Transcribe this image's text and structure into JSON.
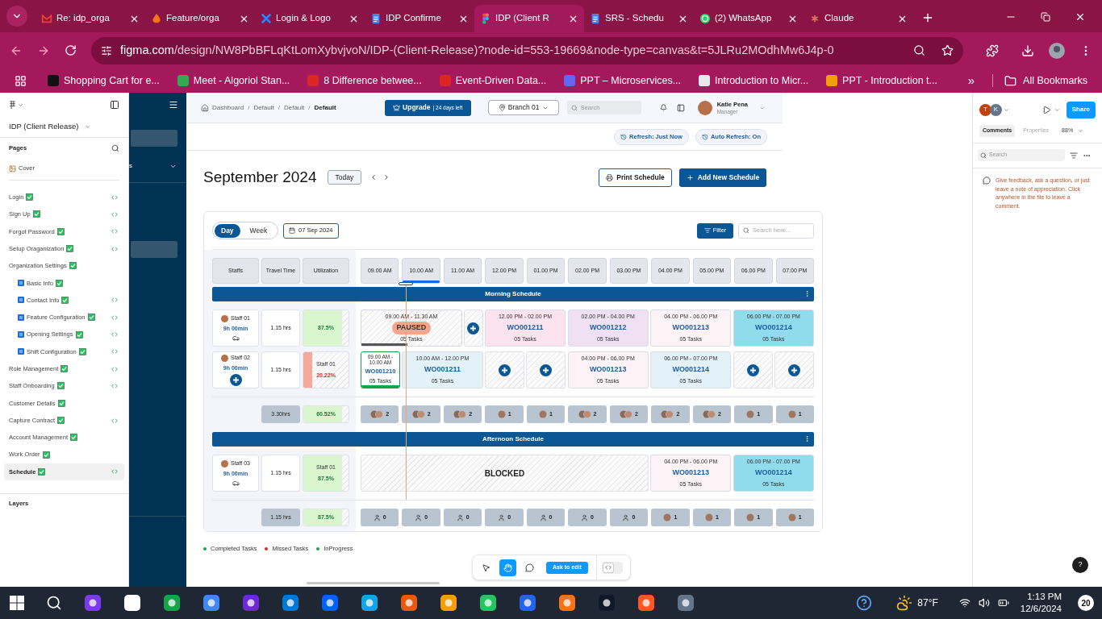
{
  "browser": {
    "tabs": [
      {
        "title": "Re: idp_orga",
        "selected": false
      },
      {
        "title": "Feature/orga",
        "selected": false
      },
      {
        "title": "Login & Logo",
        "selected": false
      },
      {
        "title": "IDP Confirme",
        "selected": false
      },
      {
        "title": "IDP (Client R",
        "selected": true
      },
      {
        "title": "SRS - Schedu",
        "selected": false
      },
      {
        "title": "(2) WhatsApp",
        "selected": false
      },
      {
        "title": "Claude",
        "selected": false
      }
    ],
    "url_domain": "figma.com",
    "url_path": "/design/NW8PbBFLqKtLomXybvjvoN/IDP-(Client-Release)?node-id=553-19669&node-type=canvas&t=5JLRu2MOdhMw6J4p-0",
    "bookmarks": [
      "Shopping Cart for e...",
      "Meet - Algoriol Stan...",
      "8 Difference betwee...",
      "Event-Driven Data...",
      "PPT – Microservices...",
      "Introduction to Micr...",
      "PPT - Introduction t..."
    ],
    "bookmarks_more": "»",
    "all_bookmarks": "All Bookmarks"
  },
  "figma": {
    "file": "IDP (Client Release)",
    "pages_title": "Pages",
    "cover": "Cover",
    "layers_title": "Layers",
    "pages": [
      {
        "name": "Login",
        "done": true,
        "dev": true,
        "selected": false
      },
      {
        "name": "Sign Up",
        "done": true,
        "dev": true,
        "selected": false
      },
      {
        "name": "Forgot Password",
        "done": true,
        "dev": true,
        "selected": false
      },
      {
        "name": "Setup Oraganization",
        "done": true,
        "dev": true,
        "selected": false
      },
      {
        "name": "Organization Settings",
        "done": true,
        "dev": false,
        "selected": false,
        "children": [
          {
            "name": "Basic Info",
            "done": true,
            "dev": false,
            "selected": false
          },
          {
            "name": "Contact Info",
            "done": true,
            "dev": true,
            "selected": false
          },
          {
            "name": "Feature Configuration",
            "done": true,
            "dev": true,
            "selected": false
          },
          {
            "name": "Opening Settings",
            "done": true,
            "dev": true,
            "selected": false
          },
          {
            "name": "Shift Configuration",
            "done": true,
            "dev": true,
            "selected": false
          }
        ]
      },
      {
        "name": "Role Management",
        "done": true,
        "dev": true,
        "selected": false
      },
      {
        "name": "Staff Onboarding",
        "done": true,
        "dev": true,
        "selected": false
      },
      {
        "name": "Customer Details",
        "done": true,
        "dev": false,
        "selected": false
      },
      {
        "name": "Capture Contract",
        "done": true,
        "dev": true,
        "selected": false
      },
      {
        "name": "Account Management",
        "done": true,
        "dev": false,
        "selected": false
      },
      {
        "name": "Work Order",
        "done": true,
        "dev": false,
        "selected": false
      },
      {
        "name": "Schedule",
        "done": true,
        "dev": true,
        "selected": true
      }
    ]
  },
  "design": {
    "nav_fragment": "s",
    "breadcrumb": [
      {
        "label": "Dashboard",
        "current": false
      },
      {
        "separator": "/",
        "label": "Default",
        "current": false
      },
      {
        "separator": "/",
        "label": "Default",
        "current": false
      },
      {
        "separator": "/",
        "label": "Default",
        "current": true
      }
    ],
    "upgrade": "Upgrade",
    "upgrade_note": "| 24 days left",
    "branch": "Branch 01",
    "search_placeholder": "Search",
    "user": {
      "name": "Katie Pena",
      "role": "Manager"
    },
    "refresh": [
      "Refresh: Just Now",
      "Auto Refresh: On"
    ],
    "title": "September 2024",
    "today": "Today",
    "print": "Print Schedule",
    "add": "Add New Schedule",
    "views": [
      {
        "label": "Day",
        "selected": true
      },
      {
        "label": "Week",
        "selected": false
      }
    ],
    "date": "07 Sep 2024",
    "filter": "Filter",
    "schedule_search_placeholder": "Search here...",
    "columns": [
      "Staffs",
      "Travel Time",
      "Utilization"
    ],
    "times": [
      {
        "label": "09.00 AM",
        "selected": false
      },
      {
        "label": "10.00 AM",
        "selected": true
      },
      {
        "label": "11.00 AM",
        "selected": false
      },
      {
        "label": "12.00 PM",
        "selected": false
      },
      {
        "label": "01.00 PM",
        "selected": false
      },
      {
        "label": "02.00 PM",
        "selected": false
      },
      {
        "label": "03.00 PM",
        "selected": false
      },
      {
        "label": "04.00 PM",
        "selected": false
      },
      {
        "label": "05.00 PM",
        "selected": false
      },
      {
        "label": "06.00 PM",
        "selected": false
      },
      {
        "label": "07.00 PM",
        "selected": false
      }
    ],
    "sections": [
      {
        "title": "Morning Schedule",
        "lanes": [
          {
            "staff": "Staff 01",
            "hours": "9h 00min",
            "kind": "car",
            "travel": "1.15 hrs",
            "utilization": {
              "value": "87.5%",
              "level": 0.85,
              "kind": "good"
            },
            "bookings": [
              {
                "kind": "paused",
                "time": "09.00 AM - 11.30 AM",
                "status": "PAUSED",
                "tasks": "05 Tasks",
                "level": 0.46
              },
              {
                "kind": "add"
              },
              {
                "kind": "order",
                "time": "12.00 PM - 02.00 PM",
                "order": "WO001211",
                "tasks": "05 Tasks",
                "color": "#fde3ee",
                "completed": false
              },
              {
                "kind": "order",
                "time": "02.00 PM - 04.00 PM",
                "order": "WO001212",
                "tasks": "05 Tasks",
                "color": "#f0e0f4",
                "completed": false
              },
              {
                "kind": "order",
                "time": "04.00 PM - 06.00 PM",
                "order": "WO001213",
                "tasks": "05 Tasks",
                "color": "#fdf3f7",
                "completed": false
              },
              {
                "kind": "order",
                "time": "06.00 PM - 07.00 PM",
                "order": "WO001214",
                "tasks": "05 Tasks",
                "color": "#90dcec",
                "completed": false
              }
            ]
          },
          {
            "staff": "Staff 02",
            "hours": "9h 00min",
            "kind": "add",
            "travel": "1.15 hrs",
            "utilization": {
              "name": "Staff 01",
              "value": "20.22%",
              "level": 0.2,
              "kind": "low"
            },
            "bookings": [
              {
                "kind": "order",
                "time": "09.00 AM - 10.00 AM",
                "order": "WO001210",
                "tasks": "05 Tasks",
                "color": "#ffffff",
                "completed": true
              },
              {
                "kind": "order",
                "time": "10.00 AM - 12.00 PM",
                "order": "WO001211",
                "tasks": "05 Tasks",
                "color": "#e3f1f8",
                "completed": false
              },
              {
                "kind": "add"
              },
              {
                "kind": "add"
              },
              {
                "kind": "order",
                "time": "04.00 PM - 06.00 PM",
                "order": "WO001213",
                "tasks": "05 Tasks",
                "color": "#fdf3f7",
                "completed": false
              },
              {
                "kind": "order",
                "time": "06.00 PM - 07.00 PM",
                "order": "WO001214",
                "tasks": "05 Tasks",
                "color": "#e3f1f8",
                "completed": false
              },
              {
                "kind": "add"
              },
              {
                "kind": "add"
              }
            ]
          }
        ],
        "summary": {
          "travel": "3.30hrs",
          "utilization": {
            "value": "60.52%",
            "level": 0.85,
            "kind": "good"
          },
          "slots": [
            {
              "kind": "pair",
              "count": "2"
            },
            {
              "kind": "pair",
              "count": "2"
            },
            {
              "kind": "pair",
              "count": "2"
            },
            {
              "kind": "single",
              "count": "1"
            },
            {
              "kind": "single",
              "count": "1"
            },
            {
              "kind": "pair",
              "count": "2"
            },
            {
              "kind": "pair",
              "count": "2"
            },
            {
              "kind": "pair",
              "count": "2"
            },
            {
              "kind": "pair",
              "count": "2"
            },
            {
              "kind": "single",
              "count": "1"
            },
            {
              "kind": "single",
              "count": "1"
            }
          ]
        }
      },
      {
        "title": "Afternoon Schedule",
        "lanes": [
          {
            "staff": "Staff 03",
            "hours": "9h 00min",
            "kind": "car",
            "travel": "1.15 hrs",
            "utilization": {
              "name": "Staff 01",
              "value": "87.5%",
              "level": 0.85,
              "kind": "good"
            },
            "bookings": [
              {
                "kind": "blocked",
                "label": "BLOCKED"
              },
              {
                "kind": "order",
                "time": "04.00 PM - 06.00 PM",
                "order": "WO001213",
                "tasks": "05 Tasks",
                "color": "#fdf3f7",
                "completed": false
              },
              {
                "kind": "order",
                "time": "06.00 PM - 07.00 PM",
                "order": "WO001214",
                "tasks": "05 Tasks",
                "color": "#90dcec",
                "completed": false
              }
            ]
          }
        ],
        "summary": {
          "travel": "1.15 hrs",
          "utilization": {
            "value": "87.5%",
            "level": 0.85,
            "kind": "good"
          },
          "slots": [
            {
              "kind": "none",
              "count": "0"
            },
            {
              "kind": "none",
              "count": "0"
            },
            {
              "kind": "none",
              "count": "0"
            },
            {
              "kind": "none",
              "count": "0"
            },
            {
              "kind": "none",
              "count": "0"
            },
            {
              "kind": "none",
              "count": "0"
            },
            {
              "kind": "none",
              "count": "0"
            },
            {
              "kind": "single",
              "count": "1"
            },
            {
              "kind": "single",
              "count": "1"
            },
            {
              "kind": "single",
              "count": "1"
            },
            {
              "kind": "single",
              "count": "1"
            }
          ]
        }
      }
    ],
    "legend": [
      {
        "label": "Completed Tasks",
        "color": "#16a34a"
      },
      {
        "label": "Missed Tasks",
        "color": "#dc2626"
      },
      {
        "label": "InProgress",
        "color": "#22a34a"
      }
    ]
  },
  "figma_toolbar": {
    "dev_mode": false,
    "tools": [
      {
        "selected": false
      },
      {
        "selected": true
      },
      {
        "selected": false
      }
    ],
    "ask": "Ask to edit"
  },
  "comments_panel": {
    "avatars": [
      {
        "initial": "T",
        "color": "#c2410c"
      },
      {
        "initial": "K",
        "color": "#64748b"
      }
    ],
    "share": "Share",
    "tabs": [
      {
        "label": "Comments",
        "selected": true
      },
      {
        "label": "Properties",
        "selected": false
      }
    ],
    "zoom": "88%",
    "search_placeholder": "Search",
    "hint": "Give feedback, ask a question, or just leave a note of appreciation. Click anywhere in the file to leave a comment.",
    "help": "?"
  },
  "taskbar": {
    "weather": "87°F",
    "time": "1:13 PM",
    "date": "12/6/2024",
    "notifications": "20"
  }
}
